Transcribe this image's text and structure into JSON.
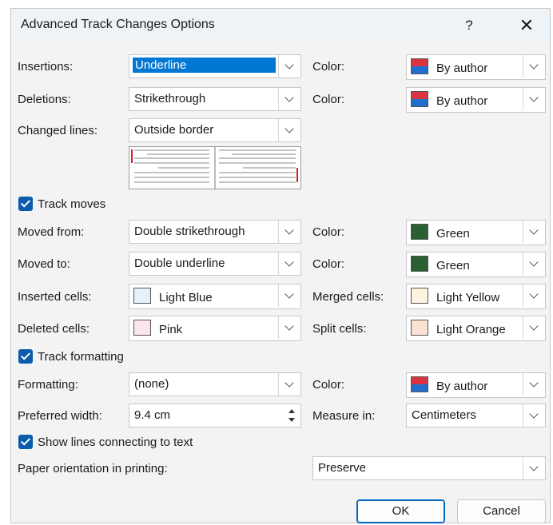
{
  "window": {
    "title": "Advanced Track Changes Options",
    "help_label": "?",
    "close_label": "✕"
  },
  "colors": {
    "accent": "#0078d4",
    "checkbox": "#0b5cad",
    "green": "#2a5e33",
    "light_blue": "#e5f1fb",
    "pink": "#fbe5ef",
    "light_yellow": "#fdf3df",
    "light_orange": "#fbe1d1"
  },
  "rows": {
    "insertions": {
      "label": "Insertions:",
      "value": "Underline",
      "color_label": "Color:",
      "color_value": "By author"
    },
    "deletions": {
      "label": "Deletions:",
      "value": "Strikethrough",
      "color_label": "Color:",
      "color_value": "By author"
    },
    "changed_lines": {
      "label": "Changed lines:",
      "value": "Outside border"
    },
    "track_moves": {
      "label": "Track moves",
      "checked": true
    },
    "moved_from": {
      "label": "Moved from:",
      "value": "Double strikethrough",
      "color_label": "Color:",
      "color_value": "Green"
    },
    "moved_to": {
      "label": "Moved to:",
      "value": "Double underline",
      "color_label": "Color:",
      "color_value": "Green"
    },
    "inserted_cells": {
      "label": "Inserted cells:",
      "value": "Light Blue",
      "merged_label": "Merged cells:",
      "merged_value": "Light Yellow"
    },
    "deleted_cells": {
      "label": "Deleted cells:",
      "value": "Pink",
      "split_label": "Split cells:",
      "split_value": "Light Orange"
    },
    "track_formatting": {
      "label": "Track formatting",
      "checked": true
    },
    "formatting": {
      "label": "Formatting:",
      "value": "(none)",
      "color_label": "Color:",
      "color_value": "By author"
    },
    "preferred_width": {
      "label": "Preferred width:",
      "value": "9.4 cm",
      "measure_label": "Measure in:",
      "measure_value": "Centimeters"
    },
    "show_lines": {
      "label": "Show lines connecting to text",
      "checked": true
    },
    "paper_orientation": {
      "label": "Paper orientation in printing:",
      "value": "Preserve"
    }
  },
  "buttons": {
    "ok": "OK",
    "cancel": "Cancel"
  }
}
